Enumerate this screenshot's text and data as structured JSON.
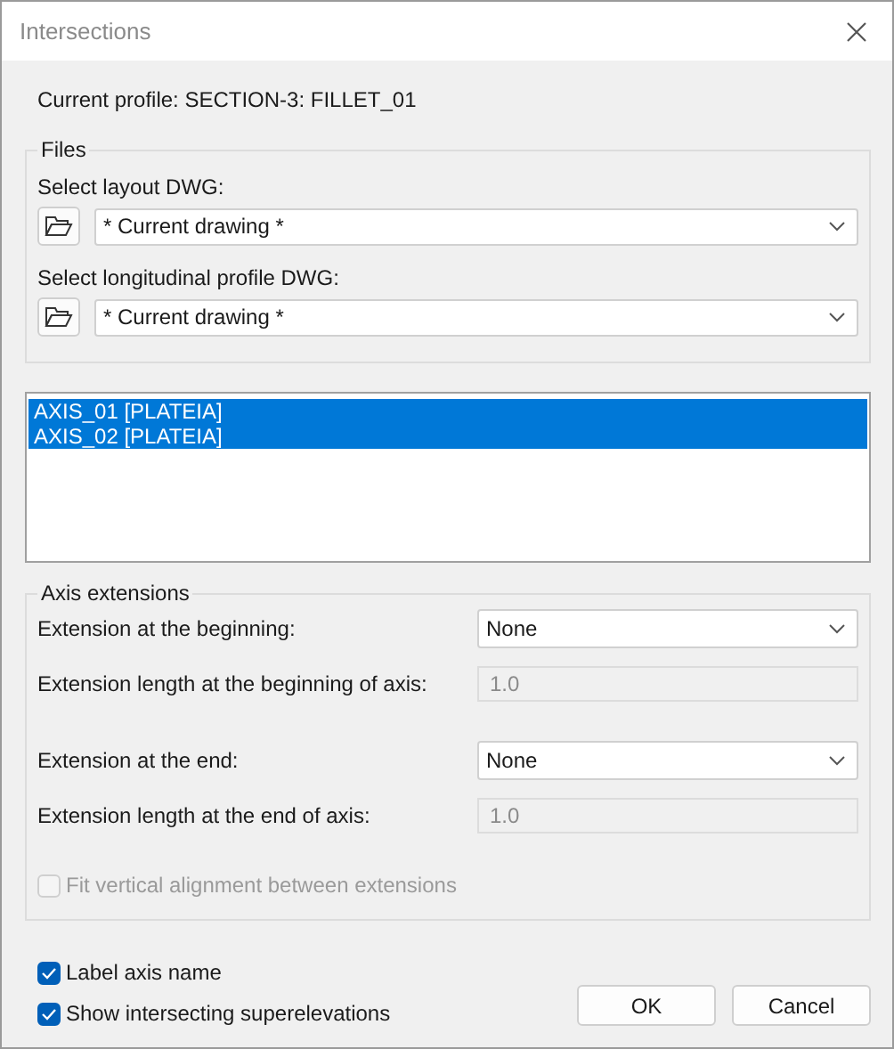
{
  "window": {
    "title": "Intersections"
  },
  "current_profile": "Current profile: SECTION-3: FILLET_01",
  "files": {
    "title": "Files",
    "fields": [
      {
        "label": "Select layout DWG:",
        "value": "* Current drawing *"
      },
      {
        "label": "Select longitudinal profile DWG:",
        "value": "* Current drawing *"
      }
    ]
  },
  "axes": [
    {
      "label": "AXIS_01 [PLATEIA]",
      "selected": true
    },
    {
      "label": "AXIS_02 [PLATEIA]",
      "selected": true
    }
  ],
  "axis_extensions": {
    "title": "Axis extensions",
    "rows": [
      {
        "kind": "select",
        "label": "Extension at the beginning:",
        "value": "None"
      },
      {
        "kind": "input",
        "label": "Extension length at the beginning of axis:",
        "value": "1.0",
        "disabled": true
      },
      {
        "kind": "select",
        "label": "Extension at the end:",
        "value": "None"
      },
      {
        "kind": "input",
        "label": "Extension length at the end of axis:",
        "value": "1.0",
        "disabled": true
      }
    ],
    "fit_vertical": {
      "label": "Fit vertical alignment between extensions",
      "checked": false,
      "disabled": true
    }
  },
  "options": [
    {
      "label": "Label axis name",
      "checked": true
    },
    {
      "label": "Show intersecting superelevations",
      "checked": true
    }
  ],
  "buttons": [
    "OK",
    "Cancel"
  ]
}
